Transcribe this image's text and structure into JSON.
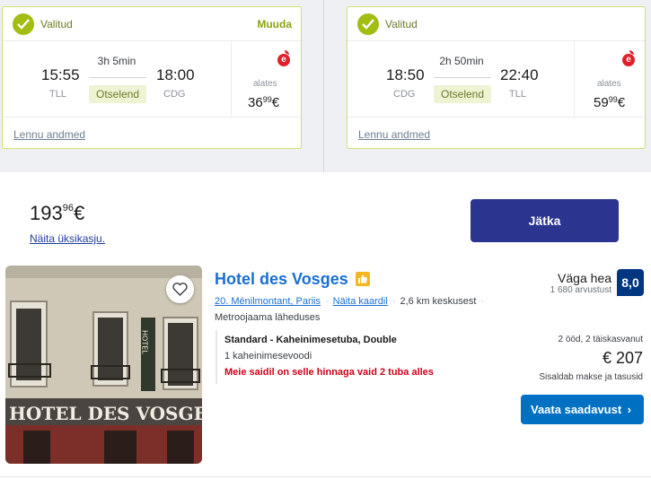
{
  "outbound": {
    "status": "Valitud",
    "change": "Muuda",
    "depart_time": "15:55",
    "depart_airport": "TLL",
    "arrive_time": "18:00",
    "arrive_airport": "CDG",
    "duration": "3h 5min",
    "stops": "Otselend",
    "from_label": "alates",
    "price_main": "36",
    "price_cents": "99",
    "price_currency": "€",
    "details": "Lennu andmed",
    "provider_icon": "estonian-air-logo"
  },
  "inbound": {
    "status": "Valitud",
    "depart_time": "18:50",
    "depart_airport": "CDG",
    "arrive_time": "22:40",
    "arrive_airport": "TLL",
    "duration": "2h 50min",
    "stops": "Otselend",
    "from_label": "alates",
    "price_main": "59",
    "price_cents": "99",
    "price_currency": "€",
    "details": "Lennu andmed",
    "provider_icon": "estonian-air-logo"
  },
  "summary": {
    "total_main": "193",
    "total_cents": "96",
    "total_currency": "€",
    "breakdown_link": "Näita üksikasju.",
    "continue": "Jätka"
  },
  "hotel": {
    "name": "Hotel des Vosges",
    "location": "20. Ménilmontant, Pariis",
    "show_map": "Näita kaardil",
    "distance": "2,6 km keskusest",
    "metro": "Metroojaama läheduses",
    "room_type": "Standard - Kaheinimesetuba, Double",
    "bed": "1 kaheinimesevoodi",
    "alert": "Meie saidil on selle hinnaga vaid 2 tuba alles",
    "rating_word": "Väga hea",
    "rating_count": "1 680 arvustust",
    "rating_score": "8,0",
    "stay_info": "2 ööd, 2 täiskasvanut",
    "price": "€ 207",
    "tax_note": "Sisaldab makse ja tasusid",
    "availability": "Vaata saadavust",
    "photo_sign": "HOTEL DES VOSGE",
    "photo_vertical_sign": "HOTEL"
  },
  "colors": {
    "accent_green": "#a3bd12",
    "card_border": "#cfe06b",
    "primary_navy": "#2b3590",
    "link_blue": "#1a6fd1",
    "button_blue": "#0071c2",
    "score_blue": "#003580",
    "alert_red": "#d0021b"
  }
}
